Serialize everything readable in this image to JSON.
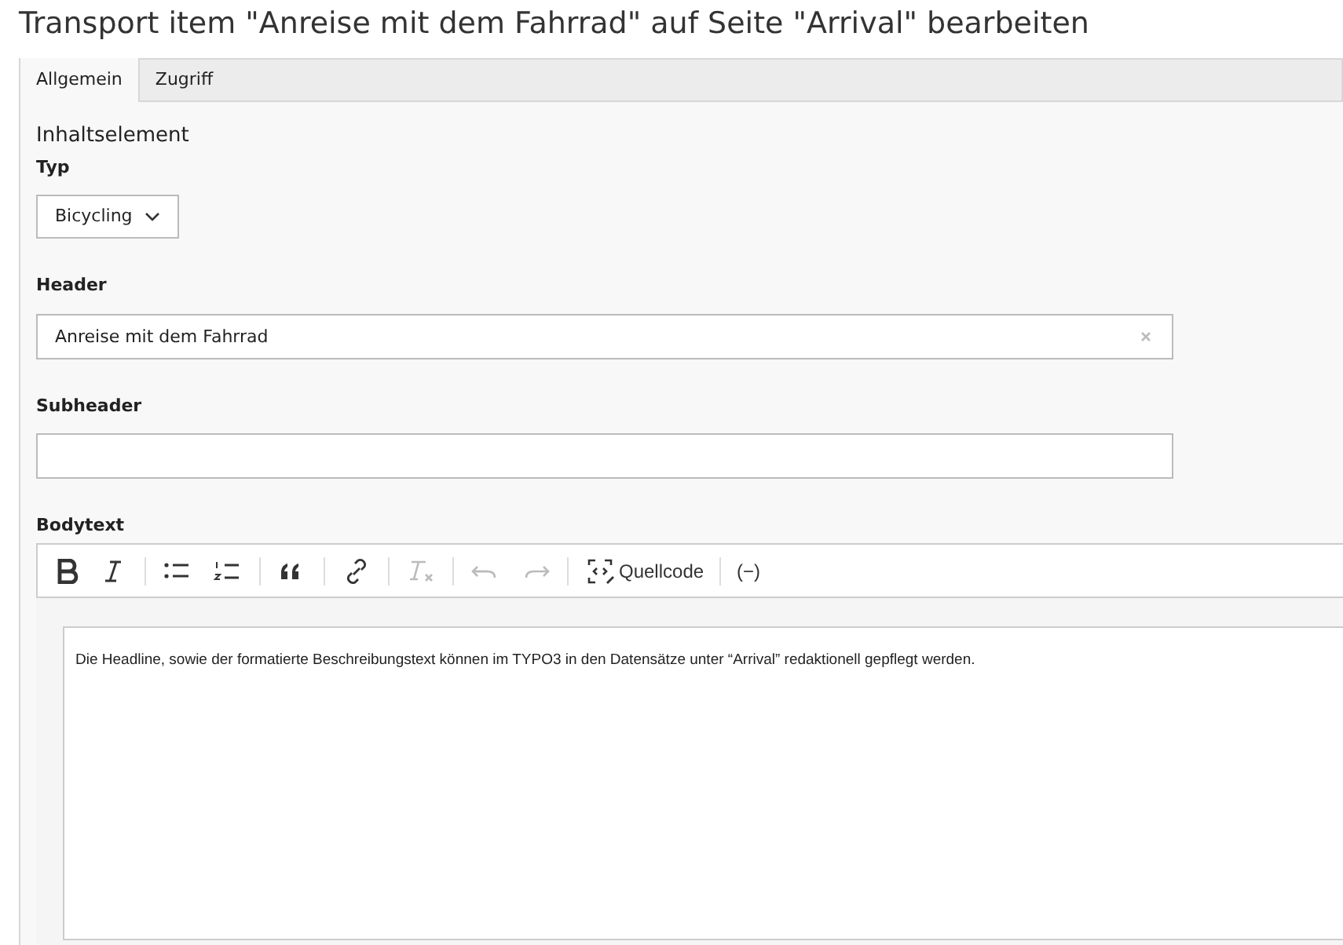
{
  "title": "Transport item \"Anreise mit dem Fahrrad\" auf Seite \"Arrival\" bearbeiten",
  "tabs": [
    {
      "label": "Allgemein",
      "selected": true
    },
    {
      "label": "Zugriff",
      "selected": false
    }
  ],
  "section_title": "Inhaltselement",
  "type_field": {
    "label": "Typ",
    "value": "Bicycling"
  },
  "header_field": {
    "label": "Header",
    "value": "Anreise mit dem Fahrrad"
  },
  "subheader_field": {
    "label": "Subheader"
  },
  "bodytext": {
    "label": "Bodytext",
    "toolbar": [
      {
        "kind": "bold",
        "disabled": false
      },
      {
        "kind": "italic",
        "disabled": false
      },
      {
        "kind": "separator"
      },
      {
        "kind": "bulleted-list",
        "disabled": false
      },
      {
        "kind": "numbered-list",
        "disabled": false
      },
      {
        "kind": "separator"
      },
      {
        "kind": "blockquote",
        "disabled": false
      },
      {
        "kind": "separator"
      },
      {
        "kind": "link",
        "disabled": false
      },
      {
        "kind": "separator"
      },
      {
        "kind": "remove-format",
        "disabled": true
      },
      {
        "kind": "separator"
      },
      {
        "kind": "undo",
        "disabled": true
      },
      {
        "kind": "redo",
        "disabled": true
      },
      {
        "kind": "separator"
      },
      {
        "kind": "source",
        "label": "Quellcode",
        "disabled": false
      },
      {
        "kind": "separator"
      },
      {
        "kind": "text",
        "label": "(−)",
        "disabled": false
      }
    ],
    "content": "Die Headline, sowie der formatierte Beschreibungstext können im TYPO3 in den Datensätze unter “Arrival” redaktionell gepflegt werden."
  }
}
